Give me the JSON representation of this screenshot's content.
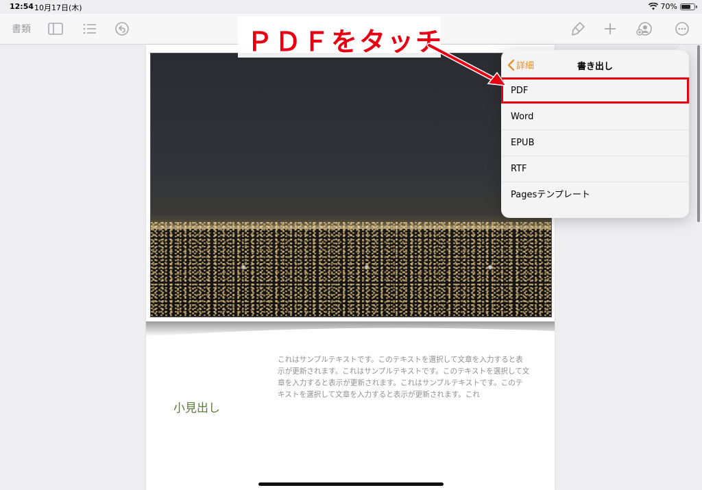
{
  "status": {
    "time": "12:54",
    "date": "10月17日(木)",
    "battery": "70%",
    "battery_level": 0.7
  },
  "toolbar": {
    "documents_label": "書類",
    "icons": [
      "sidebar-icon",
      "list-icon",
      "undo-icon",
      "paintbrush-icon",
      "plus-icon",
      "collaborate-icon",
      "more-icon"
    ]
  },
  "document": {
    "body_text": "これはサンプルテキストです。このテキストを選択して文章を入力すると表示が更新されます。これはサンプルテキストです。このテキストを選択して文章を入力すると表示が更新されます。これはサンプルテキストです。このテキストを選択して文章を入力すると表示が更新されます。これ",
    "subheading": "小見出し"
  },
  "export_popover": {
    "back_label": "詳細",
    "title": "書き出し",
    "items": [
      "PDF",
      "Word",
      "EPUB",
      "RTF",
      "Pagesテンプレート"
    ]
  },
  "annotation": {
    "text": "ＰＤＦをタッチ",
    "color": "#e60012"
  },
  "colors": {
    "accent": "#e6902b",
    "subheading": "#5d7a3a"
  }
}
